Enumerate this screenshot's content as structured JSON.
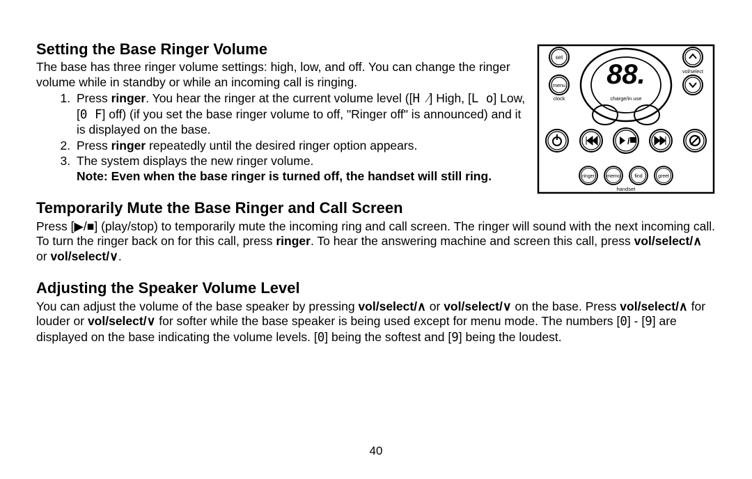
{
  "page_number": "40",
  "section1": {
    "heading": "Setting the Base Ringer Volume",
    "intro": "The base has three ringer volume settings: high, low, and off. You can change the ringer volume while in standby or while an incoming call is ringing.",
    "step1_a": "Press ",
    "step1_btn": "ringer",
    "step1_b": ". You hear the ringer at the current volume level ([",
    "step1_hi": "H ⁄",
    "step1_c": "] High, [",
    "step1_lo": "L o",
    "step1_d": "] Low, [",
    "step1_off": "0 F",
    "step1_e": "] off) (if you set the base ringer volume to off, \"Ringer off\" is announced) and it is displayed on the base.",
    "step2_a": "Press ",
    "step2_btn": "ringer",
    "step2_b": " repeatedly until the desired ringer option appears.",
    "step3": "The system displays the new ringer volume.",
    "note": "Note: Even when the base ringer is turned off, the handset will still ring."
  },
  "section2": {
    "heading": "Temporarily Mute the Base Ringer and Call Screen",
    "p_a": "Press [",
    "p_icon": "▶/■",
    "p_b": "] (play/stop) to temporarily mute the incoming ring and call screen. The ringer will sound with the next incoming call. To turn the ringer back on for this call, press ",
    "p_btn": "ringer",
    "p_c": ". To hear the answering machine and screen this call, press ",
    "vol_up": "vol/select/∧",
    "or": " or ",
    "vol_down": "vol/select/∨",
    "p_d": "."
  },
  "section3": {
    "heading": "Adjusting the Speaker Volume Level",
    "p_a": "You can adjust the volume of the base speaker by pressing ",
    "vol_up": "vol/select/∧",
    "or": " or ",
    "vol_down": "vol/select/∨",
    "p_b": " on the base. Press ",
    "p_c": " for louder or ",
    "p_d": " for softer while the base speaker is being used except for menu mode. The numbers [",
    "num0": "0",
    "p_e": "] - [",
    "num9": "9",
    "p_f": "] are displayed on the base indicating the volume levels. [",
    "p_g": "] being the softest and [",
    "p_h": "] being the loudest."
  },
  "device": {
    "set": "set",
    "menu": "menu",
    "clock": "clock",
    "vol_select": "vol/select",
    "charge": "charge/in use",
    "ringer": "ringer",
    "memo": "memo",
    "find": "find",
    "greet": "greet",
    "handset": "handset",
    "display": "88."
  }
}
